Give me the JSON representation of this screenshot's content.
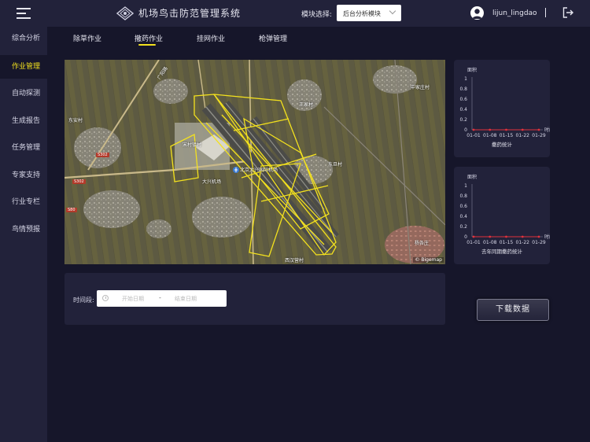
{
  "app": {
    "title": "机场鸟击防范管理系统"
  },
  "header": {
    "module_label": "模块选择:",
    "module_selected": "后台分析模块",
    "username": "lijun_lingdao"
  },
  "sidebar": {
    "items": [
      {
        "label": "综合分析",
        "active": false
      },
      {
        "label": "作业管理",
        "active": true
      },
      {
        "label": "自动探测",
        "active": false
      },
      {
        "label": "生成报告",
        "active": false
      },
      {
        "label": "任务管理",
        "active": false
      },
      {
        "label": "专家支持",
        "active": false
      },
      {
        "label": "行业专栏",
        "active": false
      },
      {
        "label": "鸟情预报",
        "active": false
      }
    ]
  },
  "tabs": [
    {
      "label": "除草作业",
      "active": false
    },
    {
      "label": "撒药作业",
      "active": true
    },
    {
      "label": "挂网作业",
      "active": false
    },
    {
      "label": "枪弹管理",
      "active": false
    }
  ],
  "map": {
    "labels": [
      "东安村",
      "中家庄村",
      "王家村",
      "宋村镇村",
      "北京大兴国际机场",
      "大兴机场",
      "东旦村",
      "杨各庄",
      "西汉营村",
      "广阳路"
    ],
    "badges": [
      "S302",
      "S302",
      "S80"
    ],
    "credit": "© Bigemap"
  },
  "charts": [
    {
      "title": "撒药统计",
      "ylabel": "面积",
      "xlabel": "时间",
      "chart_data": {
        "type": "line",
        "x": [
          "01-01",
          "01-08",
          "01-15",
          "01-22",
          "01-29"
        ],
        "series": [
          {
            "values": [
              0,
              0,
              0,
              0,
              0
            ]
          }
        ],
        "yticks": [
          "1",
          "0.8",
          "0.6",
          "0.4",
          "0.2",
          "0"
        ],
        "ylim": [
          0,
          1
        ],
        "color": "#e0323c"
      }
    },
    {
      "title": "去年同期撒药统计",
      "ylabel": "面积",
      "xlabel": "时间",
      "chart_data": {
        "type": "line",
        "x": [
          "01-01",
          "01-08",
          "01-15",
          "01-22",
          "01-29"
        ],
        "series": [
          {
            "values": [
              0,
              0,
              0,
              0,
              0
            ]
          }
        ],
        "yticks": [
          "1",
          "0.8",
          "0.6",
          "0.4",
          "0.2",
          "0"
        ],
        "ylim": [
          0,
          1
        ],
        "color": "#e0323c"
      }
    }
  ],
  "filter": {
    "label": "时间段:",
    "start_placeholder": "开始日期",
    "separator": "-",
    "end_placeholder": "结束日期"
  },
  "download_label": "下载数据",
  "colors": {
    "accent": "#f3e11e",
    "panel": "#22223a",
    "background": "#16162a",
    "line": "#e0323c"
  }
}
